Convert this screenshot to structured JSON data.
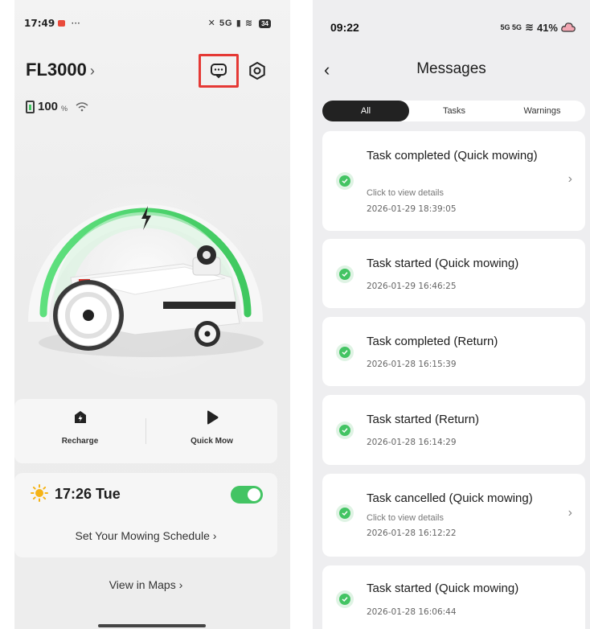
{
  "left_screen": {
    "status_bar": {
      "time": "17:49",
      "extra": "···",
      "right": "5G",
      "battery": "34"
    },
    "device": {
      "name": "FL3000",
      "chevron": "›",
      "battery_value": "100",
      "battery_unit": "%"
    },
    "actions": [
      {
        "label": "Recharge",
        "icon": "recharge-icon"
      },
      {
        "label": "Quick Mow",
        "icon": "play-icon"
      }
    ],
    "schedule": {
      "time": "17:26 Tue",
      "enabled": true,
      "link": "Set Your Mowing Schedule ›"
    },
    "maps_link": "View in Maps ›",
    "colors": {
      "accent_green": "#43c463",
      "highlight_red": "#e53935"
    }
  },
  "right_screen": {
    "status_bar": {
      "time": "09:22",
      "battery": "41%",
      "signal": "5G 5G"
    },
    "back": "‹",
    "title": "Messages",
    "tabs": [
      {
        "label": "All",
        "active": true
      },
      {
        "label": "Tasks",
        "active": false
      },
      {
        "label": "Warnings",
        "active": false
      }
    ],
    "messages": [
      {
        "title": "Task completed (Quick mowing)",
        "subtitle": "Click to view details",
        "date": "2026-01-29 18:39:05",
        "arrow": "›"
      },
      {
        "title": "Task started (Quick mowing)",
        "subtitle": "",
        "date": "2026-01-29 16:46:25",
        "arrow": ""
      },
      {
        "title": "Task completed (Return)",
        "subtitle": "",
        "date": "2026-01-28 16:15:39",
        "arrow": ""
      },
      {
        "title": "Task started (Return)",
        "subtitle": "",
        "date": "2026-01-28 16:14:29",
        "arrow": ""
      },
      {
        "title": "Task cancelled (Quick mowing)",
        "subtitle": "Click to view details",
        "date": "2026-01-28 16:12:22",
        "arrow": "›"
      },
      {
        "title": "Task started (Quick mowing)",
        "subtitle": "",
        "date": "2026-01-28 16:06:44",
        "arrow": ""
      }
    ]
  }
}
